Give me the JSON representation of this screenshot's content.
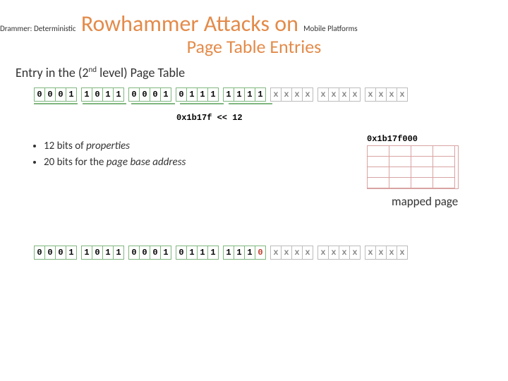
{
  "title": {
    "prefix": "Drammer: Deterministic",
    "main": " Rowhammer Attacks on ",
    "suffix": "Mobile Platforms",
    "subtitle": "Page Table Entries"
  },
  "section": {
    "label_pre": "Entry in the (2",
    "label_sup": "nd",
    "label_post": " level) Page Table"
  },
  "bitrow1": {
    "groups": [
      {
        "style": "green",
        "bits": [
          "0",
          "0",
          "0",
          "1"
        ]
      },
      {
        "style": "green",
        "bits": [
          "1",
          "0",
          "1",
          "1"
        ]
      },
      {
        "style": "green",
        "bits": [
          "0",
          "0",
          "0",
          "1"
        ]
      },
      {
        "style": "green",
        "bits": [
          "0",
          "1",
          "1",
          "1"
        ]
      },
      {
        "style": "green",
        "bits": [
          "1",
          "1",
          "1",
          "1"
        ]
      },
      {
        "style": "gray",
        "bits": [
          "x",
          "x",
          "x",
          "x"
        ]
      },
      {
        "style": "gray",
        "bits": [
          "x",
          "x",
          "x",
          "x"
        ]
      },
      {
        "style": "gray",
        "bits": [
          "x",
          "x",
          "x",
          "x"
        ]
      }
    ]
  },
  "hex_label": "0x1b17f << 12",
  "bullets": {
    "b1_pre": "12 bits of ",
    "b1_em": "properties",
    "b2_pre": "20 bits for the ",
    "b2_em": "page base address"
  },
  "page_box": {
    "addr": "0x1b17f000",
    "caption": "mapped page"
  },
  "bitrow2": {
    "groups": [
      {
        "style": "green",
        "bits": [
          "0",
          "0",
          "0",
          "1"
        ]
      },
      {
        "style": "green",
        "bits": [
          "1",
          "0",
          "1",
          "1"
        ]
      },
      {
        "style": "green",
        "bits": [
          "0",
          "0",
          "0",
          "1"
        ]
      },
      {
        "style": "green",
        "bits": [
          "0",
          "1",
          "1",
          "1"
        ]
      },
      {
        "style": "green",
        "bits": [
          "1",
          "1",
          "1",
          "0"
        ],
        "flip_index": 3
      },
      {
        "style": "gray",
        "bits": [
          "x",
          "x",
          "x",
          "x"
        ]
      },
      {
        "style": "gray",
        "bits": [
          "x",
          "x",
          "x",
          "x"
        ]
      },
      {
        "style": "gray",
        "bits": [
          "x",
          "x",
          "x",
          "x"
        ]
      }
    ]
  }
}
